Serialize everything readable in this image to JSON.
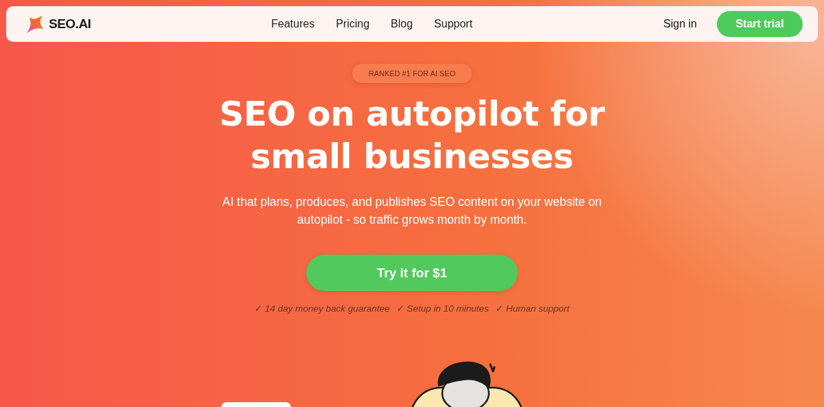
{
  "navbar": {
    "logo": "SEO.AI",
    "links": [
      "Features",
      "Pricing",
      "Blog",
      "Support"
    ],
    "sign_in": "Sign in",
    "cta": "Start trial"
  },
  "hero": {
    "badge": "RANKED #1 FOR AI SEO",
    "headline": [
      "SEO on autopilot for",
      "small businesses"
    ],
    "subtitle": "AI that plans, produces, and publishes SEO content on your website on autopilot - so traffic grows month by month.",
    "button": "Try it for $1",
    "perks": [
      "✓ 14 day money back guarantee",
      "✓ Setup in 10 minutes",
      "✓ Human support"
    ]
  }
}
